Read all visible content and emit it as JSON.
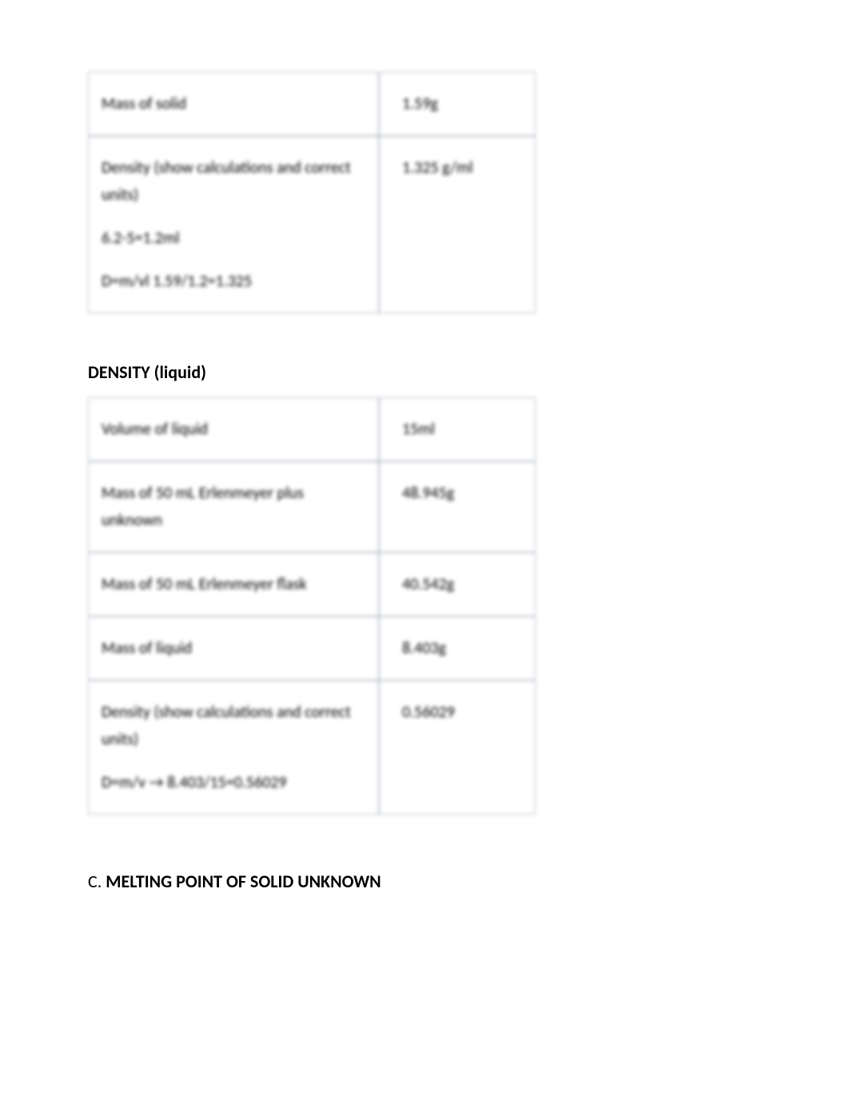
{
  "table1": {
    "rows": [
      {
        "label": "Mass of solid",
        "value": "1.59g"
      },
      {
        "label": "Density (show calculations and correct units)",
        "calc1": "6.2-5=1.2ml",
        "calc2": "D=m/vl  1.59/1.2=1.325",
        "value": "1.325 g/ml"
      }
    ]
  },
  "heading1": "DENSITY (liquid)",
  "table2": {
    "rows": [
      {
        "label": "Volume of liquid",
        "value": "15ml"
      },
      {
        "label": "Mass of 50 mL Erlenmeyer plus unknown",
        "value": "48.945g"
      },
      {
        "label": "Mass of 50 mL Erlenmeyer flask",
        "value": "40.542g"
      },
      {
        "label": "Mass of liquid",
        "value": "8.403g"
      },
      {
        "label": "Density (show calculations and correct units)",
        "calc1": "D=m/v → 8.403/15=0.56029",
        "value": "0.56029"
      }
    ]
  },
  "heading2_prefix": "C. ",
  "heading2": "MELTING POINT OF SOLID UNKNOWN"
}
